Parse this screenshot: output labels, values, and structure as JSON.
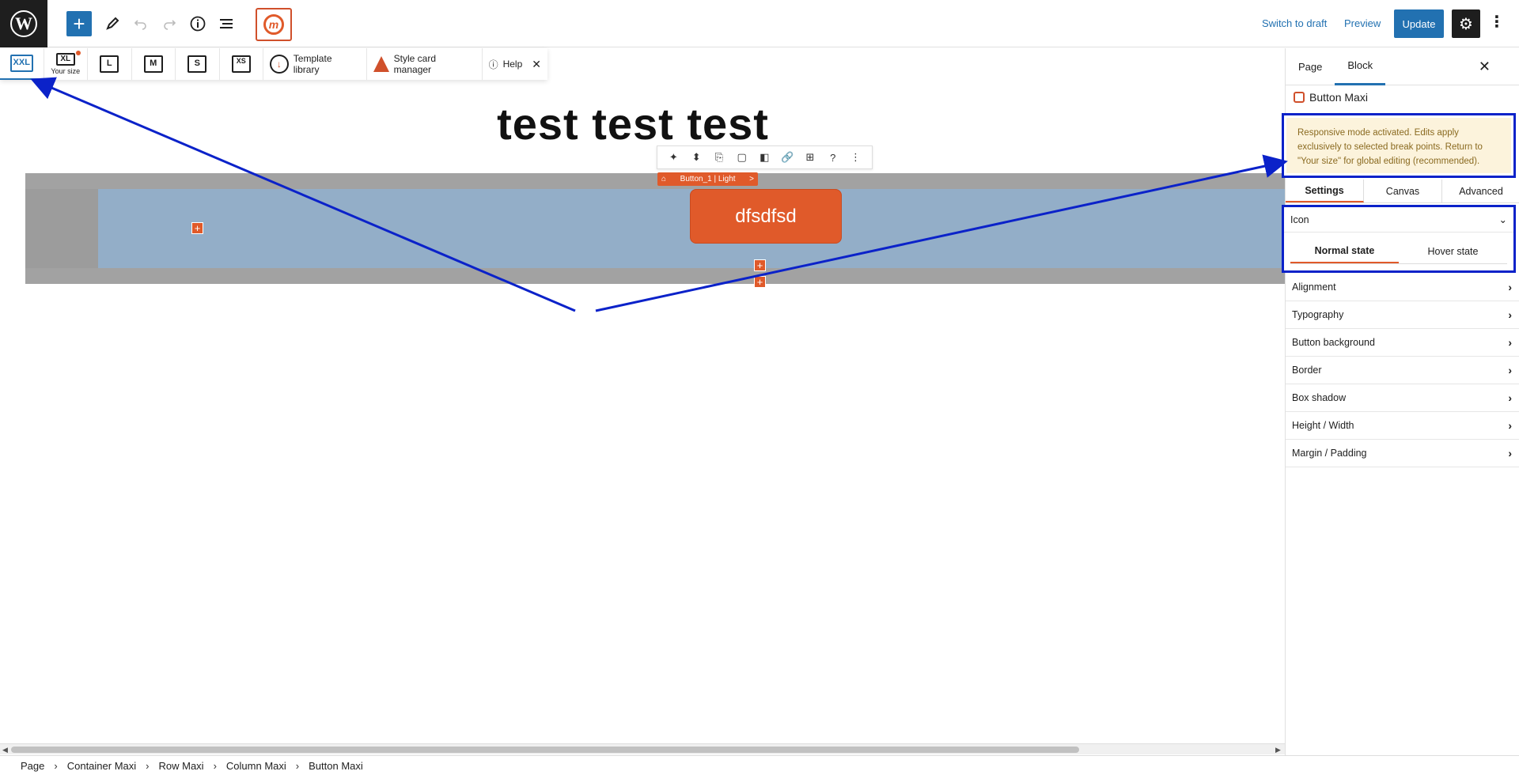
{
  "header": {
    "logo_letter": "W",
    "add_symbol": "+",
    "switch_to_draft": "Switch to draft",
    "preview": "Preview",
    "update": "Update"
  },
  "responsive_bar": {
    "breakpoints": [
      {
        "label": "XXL",
        "sub": ""
      },
      {
        "label": "XL",
        "sub": "Your size"
      },
      {
        "label": "L",
        "sub": ""
      },
      {
        "label": "M",
        "sub": ""
      },
      {
        "label": "S",
        "sub": ""
      },
      {
        "label": "XS",
        "sub": ""
      }
    ],
    "template_library": "Template library",
    "style_card_manager": "Style card manager",
    "help": "Help"
  },
  "canvas": {
    "title": "test test test",
    "button_text": "dfsdfsd",
    "block_tag": "Button_1  | Light",
    "block_tag_arrow": ">"
  },
  "breadcrumb": [
    "Page",
    "Container Maxi",
    "Row Maxi",
    "Column Maxi",
    "Button Maxi"
  ],
  "sidebar": {
    "tabs": [
      "Page",
      "Block"
    ],
    "block_name": "Button Maxi",
    "notice": "Responsive mode activated. Edits apply exclusively to selected break points. Return to \"Your size\" for global editing (recommended).",
    "sub_tabs": [
      "Settings",
      "Canvas",
      "Advanced"
    ],
    "icon_section": "Icon",
    "states": [
      "Normal state",
      "Hover state"
    ],
    "accordion": [
      "Alignment",
      "Typography",
      "Button background",
      "Border",
      "Box shadow",
      "Height / Width",
      "Margin / Padding"
    ]
  },
  "colors": {
    "accent": "#2271b1",
    "maxi_orange": "#e05a2a",
    "annotation_blue": "#0b22c9",
    "notice_bg": "#fcf3dc"
  }
}
